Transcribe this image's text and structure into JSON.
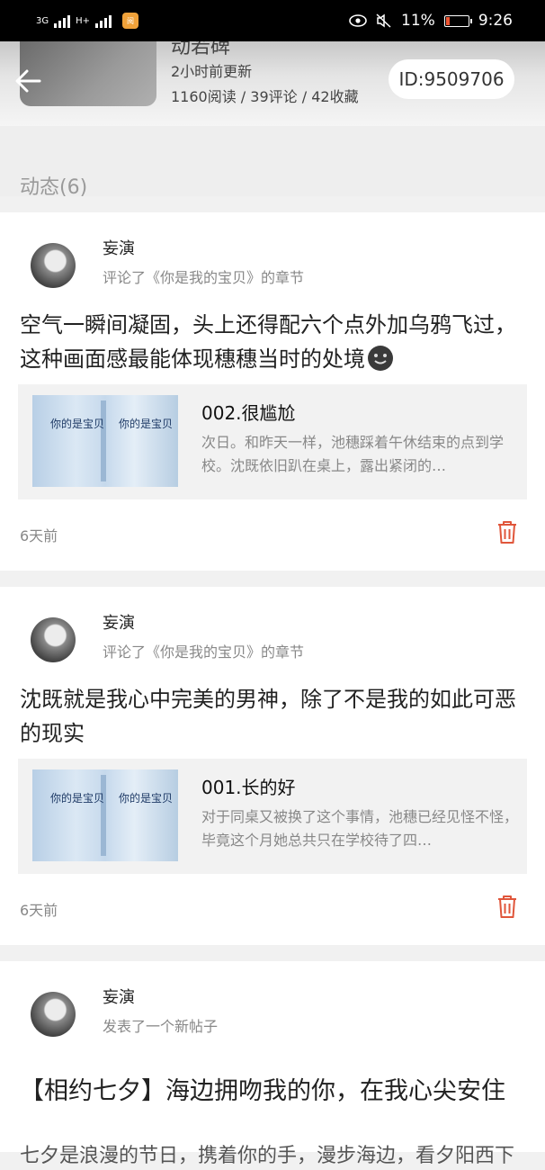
{
  "status_bar": {
    "network1": "3G",
    "network2": "H+",
    "battery_percent": "11%",
    "time": "9:26"
  },
  "book": {
    "title_partial": "动若碑",
    "updated": "2小时前更新",
    "stats": "1160阅读 / 39评论 / 42收藏",
    "id_label": "ID:9509706"
  },
  "section": {
    "title": "动态(6)"
  },
  "feed": [
    {
      "user": "妄演",
      "action": "评论了《你是我的宝贝》的章节",
      "comment": "空气一瞬间凝固，头上还得配六个点外加乌鸦飞过，这种画面感最能体现穗穗当时的处境",
      "chapter_title": "002.很尴尬",
      "chapter_excerpt": "次日。和昨天一样，池穗踩着午休结束的点到学校。沈既依旧趴在桌上，露出紧闭的…",
      "time": "6天前",
      "cover_text": "你的是宝贝"
    },
    {
      "user": "妄演",
      "action": "评论了《你是我的宝贝》的章节",
      "comment": "沈既就是我心中完美的男神，除了不是我的如此可恶的现实",
      "chapter_title": "001.长的好",
      "chapter_excerpt": "对于同桌又被换了这个事情，池穗已经见怪不怪，毕竟这个月她总共只在学校待了四…",
      "time": "6天前",
      "cover_text": "你的是宝贝"
    },
    {
      "user": "妄演",
      "action": "发表了一个新帖子",
      "post_title": "【相约七夕】海边拥吻我的你，在我心尖安住",
      "post_excerpt": "七夕是浪漫的节日，携着你的手，漫步海边，看夕阳西下"
    }
  ],
  "icons": {
    "back": "back-arrow-icon",
    "delete": "trash-icon",
    "emoji": "smiling-face-icon"
  },
  "colors": {
    "accent": "#e0563b",
    "muted": "#888888"
  }
}
